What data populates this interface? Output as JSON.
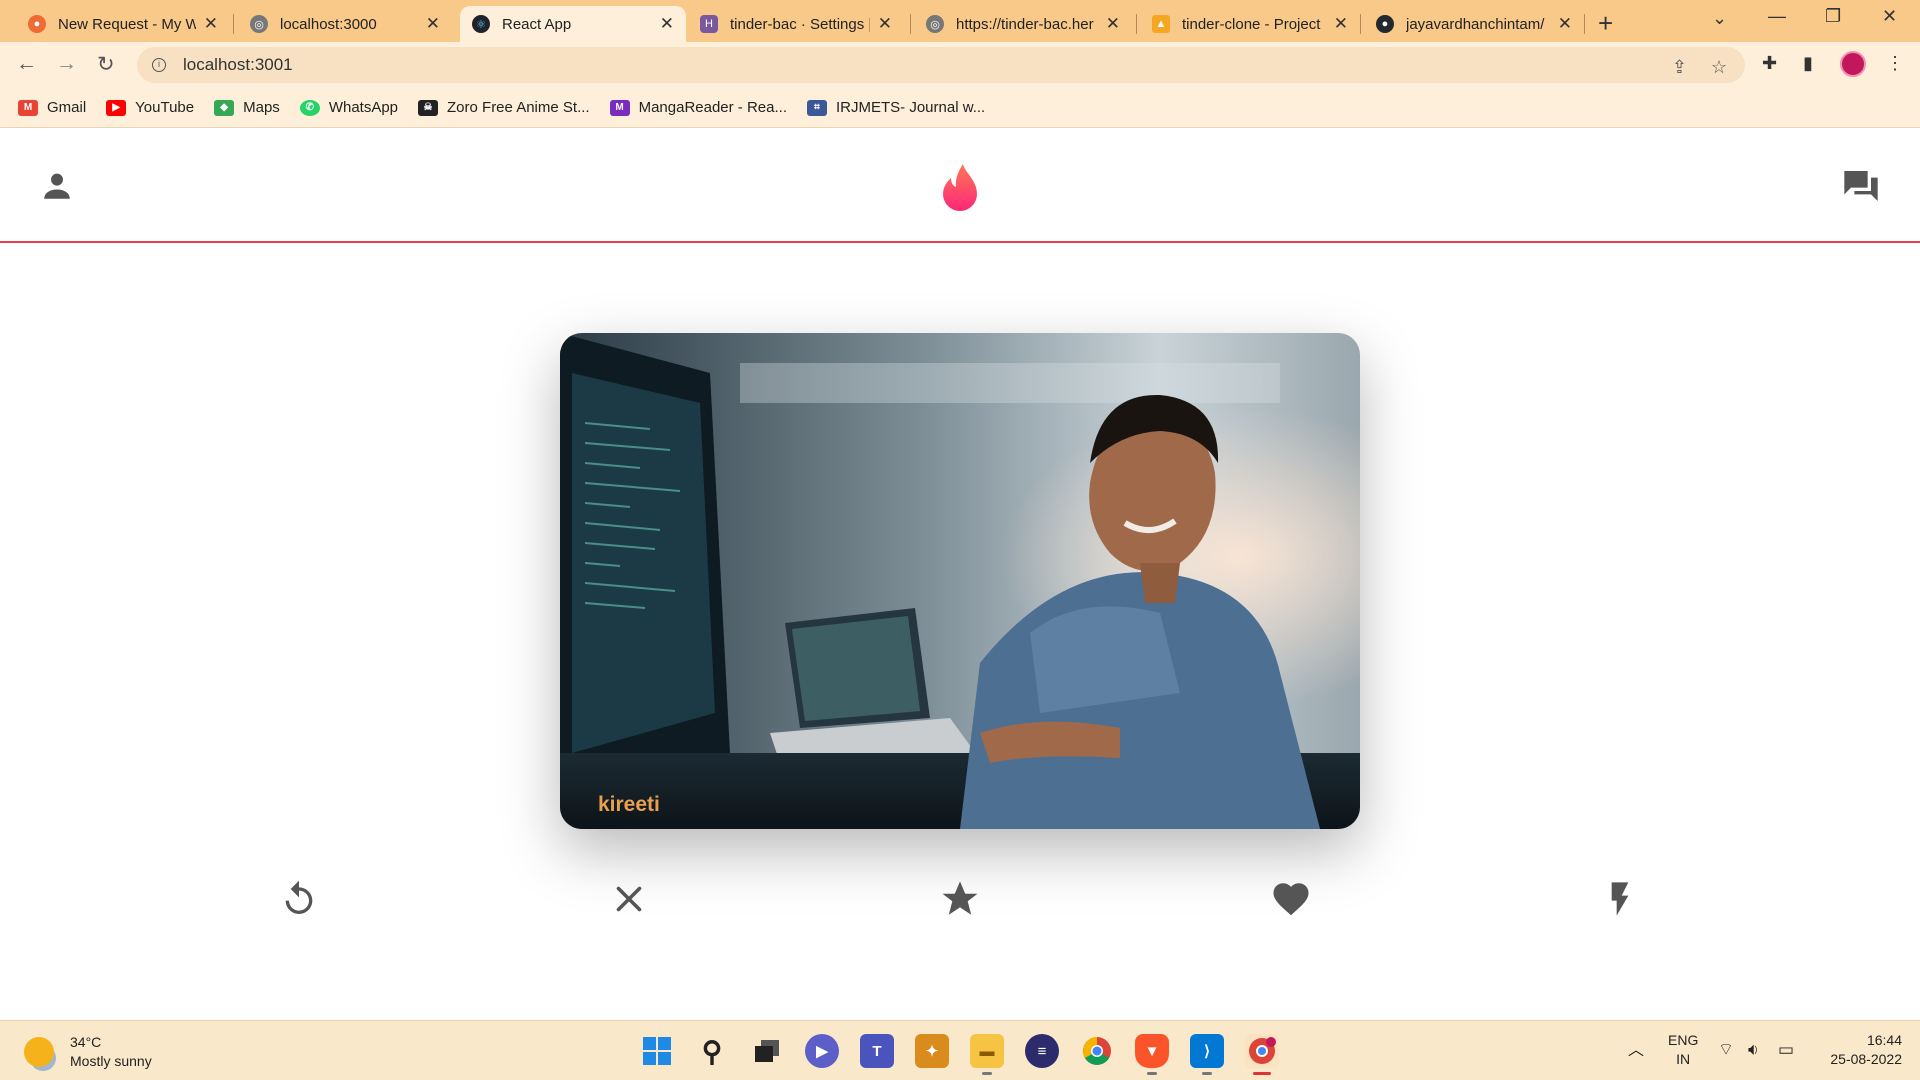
{
  "browser": {
    "tabs": [
      {
        "label": "New Request - My W",
        "favicon": "postman-icon",
        "color": "#f06a35"
      },
      {
        "label": "localhost:3000",
        "favicon": "globe-icon",
        "color": "#777777"
      },
      {
        "label": "React App",
        "favicon": "react-icon",
        "color": "#20232a"
      },
      {
        "label": "tinder-bac · Settings |",
        "favicon": "heroku-icon",
        "color": "#79589f"
      },
      {
        "label": "https://tinder-bac.her",
        "favicon": "globe-icon",
        "color": "#777777"
      },
      {
        "label": "tinder-clone - Project",
        "favicon": "firebase-icon",
        "color": "#f5a623"
      },
      {
        "label": "jayavardhanchintam/",
        "favicon": "github-icon",
        "color": "#24292e"
      }
    ],
    "active_tab": 2,
    "url": "localhost:3001",
    "bookmarks": [
      {
        "label": "Gmail",
        "icon": "gmail-icon",
        "color": "#ea4335"
      },
      {
        "label": "YouTube",
        "icon": "youtube-icon",
        "color": "#ff0000"
      },
      {
        "label": "Maps",
        "icon": "maps-icon",
        "color": "#34a853"
      },
      {
        "label": "WhatsApp",
        "icon": "whatsapp-icon",
        "color": "#25d366"
      },
      {
        "label": "Zoro Free Anime St...",
        "icon": "zoro-icon",
        "color": "#222222"
      },
      {
        "label": "MangaReader - Rea...",
        "icon": "mangareader-icon",
        "color": "#7b2cbf"
      },
      {
        "label": "IRJMETS- Journal w...",
        "icon": "irjmets-icon",
        "color": "#3b5998"
      }
    ]
  },
  "app": {
    "accent": "#ea3e4f",
    "header_icons": {
      "left": "person-icon",
      "center": "tinder-flame-icon",
      "right": "chat-icon"
    },
    "card": {
      "name": "kireeti",
      "photo": "card-photo"
    },
    "actions": [
      {
        "name": "undo-button",
        "icon": "replay-icon"
      },
      {
        "name": "nope-button",
        "icon": "close-icon"
      },
      {
        "name": "superlike-button",
        "icon": "star-icon"
      },
      {
        "name": "like-button",
        "icon": "heart-icon"
      },
      {
        "name": "boost-button",
        "icon": "flash-icon"
      }
    ]
  },
  "taskbar": {
    "weather_temp": "34°C",
    "weather_desc": "Mostly sunny",
    "lang_top": "ENG",
    "lang_bottom": "IN",
    "time": "16:44",
    "date": "25-08-2022"
  }
}
